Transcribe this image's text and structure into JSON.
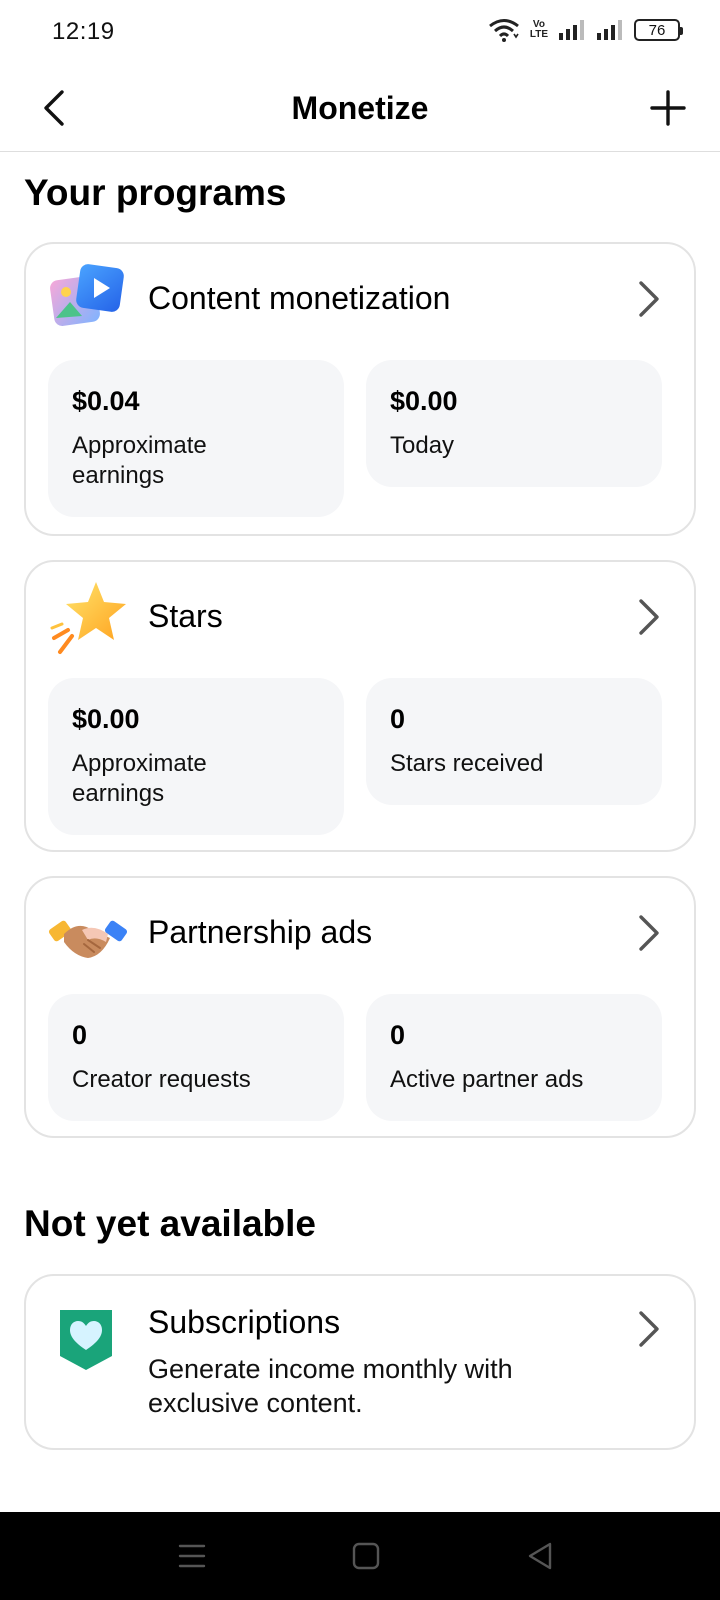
{
  "status_bar": {
    "time": "12:19",
    "battery": "76",
    "volte_top": "Vo",
    "volte_bottom": "LTE"
  },
  "header": {
    "title": "Monetize"
  },
  "sections": {
    "programs_title": "Your programs",
    "not_available_title": "Not yet available"
  },
  "programs": [
    {
      "title": "Content monetization",
      "icon": "photo-video-icon",
      "stats": [
        {
          "value": "$0.04",
          "label": "Approximate earnings"
        },
        {
          "value": "$0.00",
          "label": "Today"
        }
      ]
    },
    {
      "title": "Stars",
      "icon": "star-icon",
      "stats": [
        {
          "value": "$0.00",
          "label": "Approximate earnings"
        },
        {
          "value": "0",
          "label": "Stars received"
        }
      ]
    },
    {
      "title": "Partnership ads",
      "icon": "handshake-icon",
      "stats": [
        {
          "value": "0",
          "label": "Creator requests"
        },
        {
          "value": "0",
          "label": "Active partner ads"
        }
      ]
    }
  ],
  "unavailable": [
    {
      "title": "Subscriptions",
      "description": "Generate income monthly with exclusive content.",
      "icon": "heart-badge-icon"
    }
  ],
  "colors": {
    "card_border": "#e3e3e3",
    "stat_bg": "#f5f6f8",
    "subscription_green": "#1aa47a"
  }
}
